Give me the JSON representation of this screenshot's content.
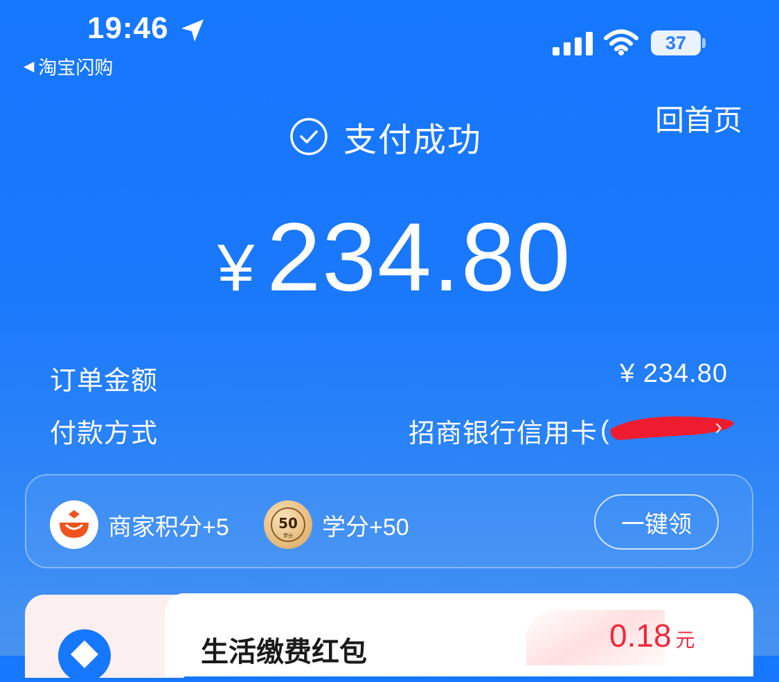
{
  "status_bar": {
    "time": "19:46",
    "back_app": "淘宝闪购",
    "battery": "37"
  },
  "header": {
    "home_link": "回首页",
    "status_text": "支付成功",
    "currency_symbol": "¥",
    "amount": "234.80"
  },
  "details": {
    "order_label": "订单金额",
    "order_value": "¥ 234.80",
    "payment_label": "付款方式",
    "payment_value": "招商银行信用卡",
    "payment_masked": "(",
    "payment_close": ")"
  },
  "rewards": {
    "merchant_points": "商家积分+5",
    "credit_badge": "50",
    "credit_badge_sub": "学分",
    "credits": "学分+50",
    "claim_button": "一键领"
  },
  "bottom_card": {
    "title": "生活缴费红包",
    "amount": "0.18",
    "unit": "元"
  },
  "colors": {
    "background": "#1677ff",
    "accent_red": "#f0283c",
    "merchant_icon": "#f0531e",
    "credit_gold": "#e3b676"
  },
  "icons": [
    "location-arrow-icon",
    "signal-icon",
    "wifi-icon",
    "battery-icon",
    "check-circle-icon",
    "merchant-points-icon",
    "credit-badge-icon",
    "chevron-right-icon",
    "bill-icon"
  ]
}
